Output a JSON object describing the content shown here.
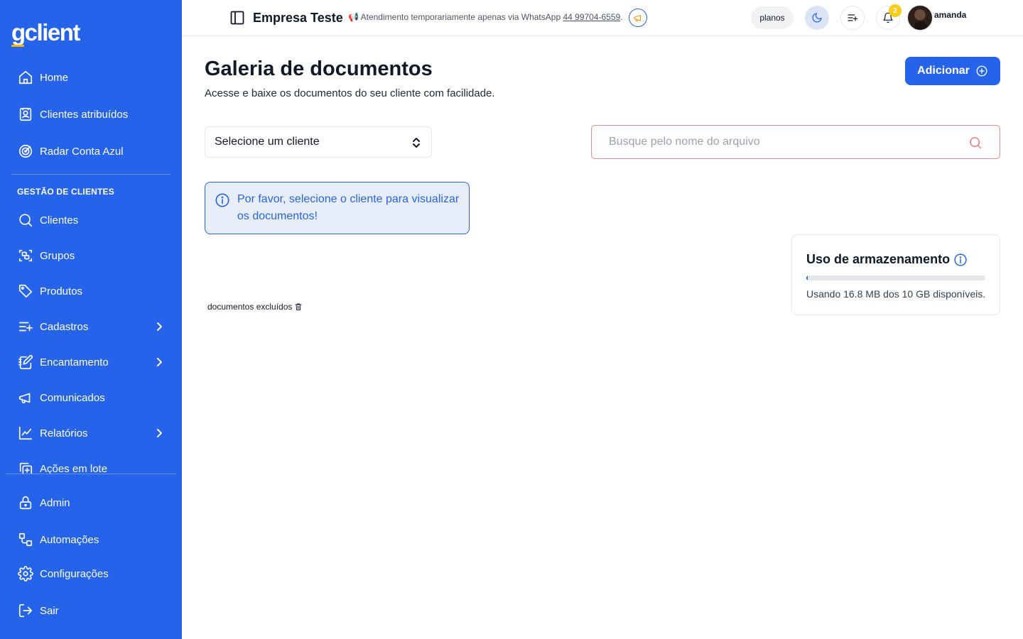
{
  "sidebar": {
    "logo": {
      "g": "g",
      "rest": "client"
    },
    "items_top": [
      {
        "label": "Home",
        "icon": "home-icon"
      },
      {
        "label": "Clientes atribuídos",
        "icon": "contact-book-icon"
      },
      {
        "label": "Radar Conta Azul",
        "icon": "radar-icon"
      }
    ],
    "section_label": "GESTÃO DE CLIENTES",
    "items_mid": [
      {
        "label": "Clientes",
        "icon": "search-icon"
      },
      {
        "label": "Grupos",
        "icon": "group-icon"
      },
      {
        "label": "Produtos",
        "icon": "tag-icon"
      },
      {
        "label": "Cadastros",
        "icon": "list-plus-icon",
        "has_children": true
      },
      {
        "label": "Encantamento",
        "icon": "notebook-pen-icon",
        "has_children": true
      },
      {
        "label": "Comunicados",
        "icon": "megaphone-icon"
      },
      {
        "label": "Relatórios",
        "icon": "line-chart-icon",
        "has_children": true
      },
      {
        "label": "Ações em lote",
        "icon": "copy-plus-icon"
      }
    ],
    "items_bottom": [
      {
        "label": "Admin",
        "icon": "lock-icon"
      },
      {
        "label": "Automações",
        "icon": "workflow-icon"
      },
      {
        "label": "Configurações",
        "icon": "gear-icon"
      },
      {
        "label": "Sair",
        "icon": "logout-icon"
      }
    ]
  },
  "topbar": {
    "company_name": "Empresa Teste",
    "notice_emoji": "📢",
    "notice_text": "Atendimento temporariamente apenas via WhatsApp",
    "notice_phone": "44 99704-6559",
    "notice_end": ".",
    "plans_label": "planos",
    "notifications_count": "2",
    "username": "amanda"
  },
  "main": {
    "title": "Galeria de documentos",
    "subtitle": "Acesse e baixe os documentos do seu cliente com facilidade.",
    "add_button_label": "Adicionar",
    "client_select_value": "Selecione um cliente",
    "search_placeholder": "Busque pelo nome do arquivo",
    "alert_text": "Por favor, selecione o cliente para visualizar os documentos!",
    "deleted_link_label": "documentos excluídos"
  },
  "storage": {
    "title": "Uso de armazenamento",
    "used_fraction": 0.0016,
    "usage_text": "Usando 16.8 MB dos 10 GB disponíveis."
  },
  "colors": {
    "sidebar_bg": "#2563eb",
    "primary": "#2563eb",
    "logo_accent": "#f5b800",
    "badge": "#facc15",
    "search_border": "#f08a8a"
  }
}
